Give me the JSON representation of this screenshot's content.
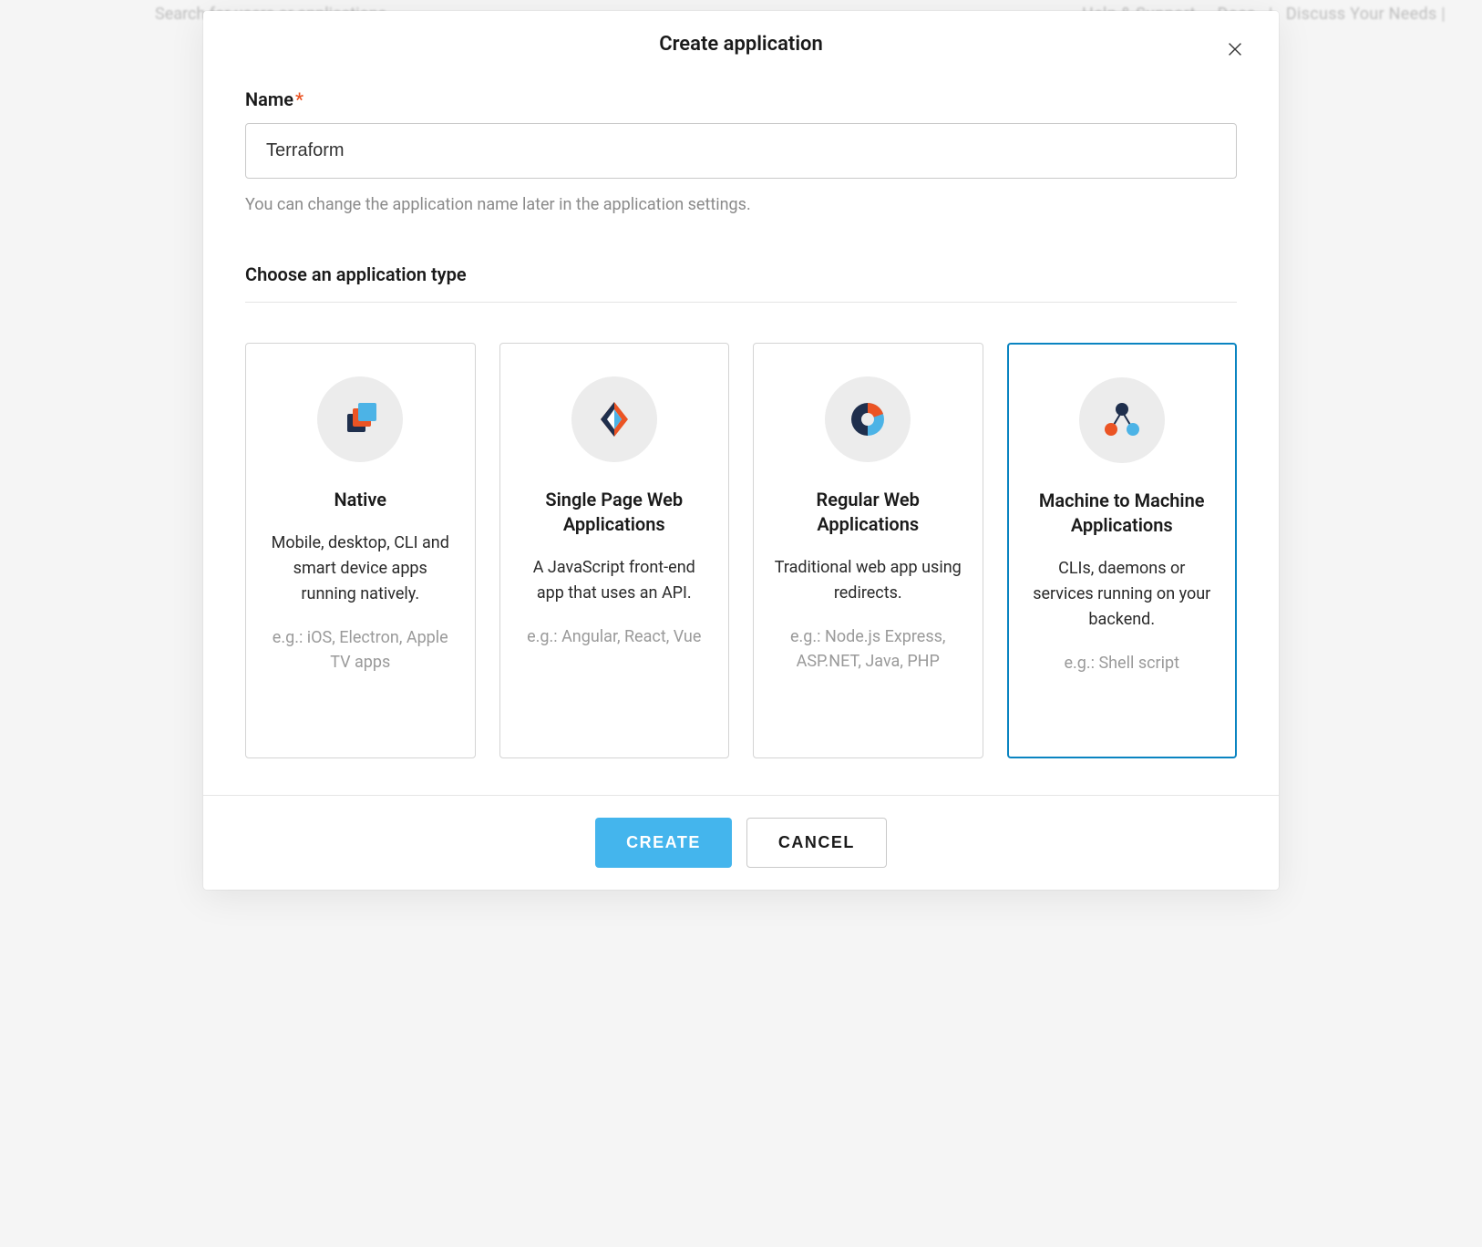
{
  "background": {
    "search_placeholder": "Search for users or applications",
    "help": "Help & Support",
    "docs": "Docs",
    "discuss": "Discuss Your Needs"
  },
  "modal": {
    "title": "Create application",
    "name_label": "Name",
    "name_value": "Terraform",
    "name_help": "You can change the application name later in the application settings.",
    "type_section": "Choose an application type",
    "cards": [
      {
        "title": "Native",
        "desc": "Mobile, desktop, CLI and smart device apps running natively.",
        "example": "e.g.: iOS, Electron, Apple TV apps"
      },
      {
        "title": "Single Page Web Applications",
        "desc": "A JavaScript front-end app that uses an API.",
        "example": "e.g.: Angular, React, Vue"
      },
      {
        "title": "Regular Web Applications",
        "desc": "Traditional web app using redirects.",
        "example": "e.g.: Node.js Express, ASP.NET, Java, PHP"
      },
      {
        "title": "Machine to Machine Applications",
        "desc": "CLIs, daemons or services running on your backend.",
        "example": "e.g.: Shell script"
      }
    ],
    "create_button": "CREATE",
    "cancel_button": "CANCEL"
  }
}
